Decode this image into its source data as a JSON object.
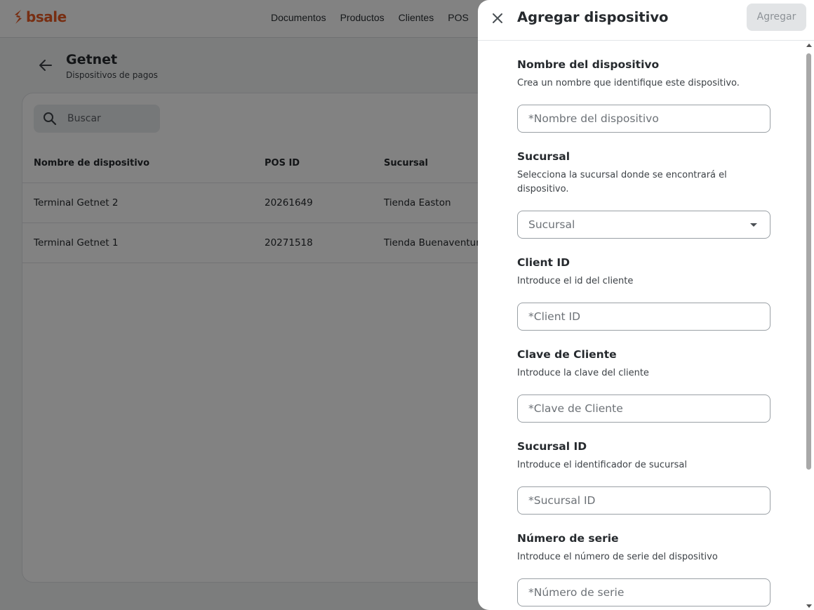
{
  "brand": {
    "logo_text": "bsale",
    "color": "#ea5a24"
  },
  "nav": {
    "items": [
      "Documentos",
      "Productos",
      "Clientes",
      "POS"
    ]
  },
  "page": {
    "title": "Getnet",
    "subtitle": "Dispositivos de pagos"
  },
  "search": {
    "placeholder": "Buscar"
  },
  "table": {
    "headers": [
      "Nombre de dispositivo",
      "POS ID",
      "Sucursal"
    ],
    "rows": [
      {
        "name": "Terminal Getnet 2",
        "pos_id": "20261649",
        "branch": "Tienda Easton"
      },
      {
        "name": "Terminal Getnet 1",
        "pos_id": "20271518",
        "branch": "Tienda Buenaventura"
      }
    ]
  },
  "drawer": {
    "title": "Agregar dispositivo",
    "submit_label": "Agregar",
    "fields": [
      {
        "label": "Nombre del dispositivo",
        "help": "Crea un nombre que identifique este dispositivo.",
        "placeholder": "*Nombre del dispositivo"
      },
      {
        "label": "Sucursal",
        "help": "Selecciona la sucursal donde se encontrará el dispositivo.",
        "placeholder": "Sucursal"
      },
      {
        "label": "Client ID",
        "help": "Introduce el id del cliente",
        "placeholder": "*Client ID"
      },
      {
        "label": "Clave de Cliente",
        "help": "Introduce la clave del cliente",
        "placeholder": "*Clave de Cliente"
      },
      {
        "label": "Sucursal ID",
        "help": "Introduce el identificador de sucursal",
        "placeholder": "*Sucursal ID"
      },
      {
        "label": "Número de serie",
        "help": "Introduce el número de serie del dispositivo",
        "placeholder": "*Número de serie"
      }
    ]
  }
}
